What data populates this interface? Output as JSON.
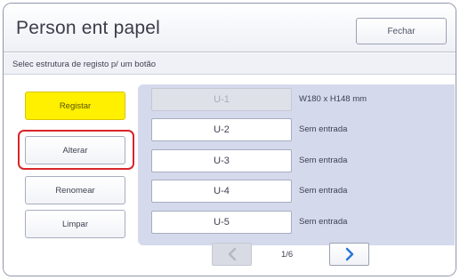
{
  "header": {
    "title": "Person ent papel",
    "close_label": "Fechar"
  },
  "subheader": {
    "text": "Selec estrutura de registo p/ um botão"
  },
  "sidebar": {
    "buttons": [
      {
        "label": "Registar",
        "active": true
      },
      {
        "label": "Alterar",
        "active": false
      },
      {
        "label": "Renomear",
        "active": false
      },
      {
        "label": "Limpar",
        "active": false
      }
    ]
  },
  "entries": [
    {
      "label": "U-1",
      "status": "W180 x H148 mm",
      "disabled": true
    },
    {
      "label": "U-2",
      "status": "Sem entrada",
      "disabled": false
    },
    {
      "label": "U-3",
      "status": "Sem entrada",
      "disabled": false
    },
    {
      "label": "U-4",
      "status": "Sem entrada",
      "disabled": false
    },
    {
      "label": "U-5",
      "status": "Sem entrada",
      "disabled": false
    }
  ],
  "pager": {
    "page": "1/6",
    "prev_icon": "chevron-left-icon",
    "next_icon": "chevron-right-icon"
  },
  "colors": {
    "active_button": "#fff000",
    "highlight_ring": "#d9252a",
    "list_background": "#d4d9ec",
    "next_arrow": "#2a78d6"
  }
}
